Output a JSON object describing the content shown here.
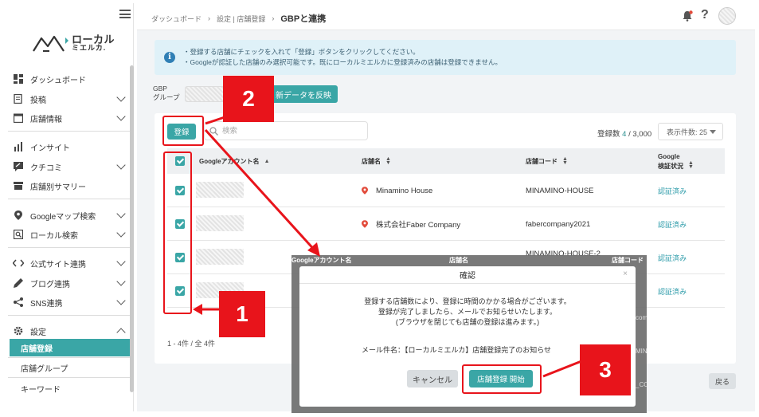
{
  "sidebar": {
    "logo_line1": "ローカル",
    "logo_line2": "ミエルカ.",
    "items": [
      {
        "label": "ダッシュボード",
        "icon": "dashboard-icon"
      },
      {
        "label": "投稿",
        "icon": "post-icon"
      },
      {
        "label": "店舗情報",
        "icon": "store-icon"
      },
      {
        "label": "インサイト",
        "icon": "insight-icon"
      },
      {
        "label": "クチコミ",
        "icon": "review-icon"
      },
      {
        "label": "店舗別サマリー",
        "icon": "shop-summary-icon"
      },
      {
        "label": "Googleマップ検索",
        "icon": "map-pin-icon"
      },
      {
        "label": "ローカル検索",
        "icon": "local-search-icon"
      },
      {
        "label": "公式サイト連携",
        "icon": "code-icon"
      },
      {
        "label": "ブログ連携",
        "icon": "pen-icon"
      },
      {
        "label": "SNS連携",
        "icon": "share-icon"
      },
      {
        "label": "設定",
        "icon": "gear-icon"
      }
    ],
    "sub_items": [
      "店舗登録",
      "店舗グループ",
      "キーワード"
    ]
  },
  "header": {
    "breadcrumb": [
      "ダッシュボード",
      "設定 | 店舗登録"
    ],
    "title": "GBPと連携"
  },
  "info": {
    "line1": "・登録する店舗にチェックを入れて「登録」ボタンをクリックしてください。",
    "line2": "・Googleが認証した店舗のみ選択可能です。既にローカルミエルカに登録済みの店舗は登録できません。"
  },
  "gbp": {
    "label_line1": "GBP",
    "label_line2": "グループ",
    "reflect_button": "新データを反映"
  },
  "toolbar": {
    "register_button": "登録",
    "search_placeholder": "検索",
    "count_prefix": "登録数",
    "count_current": "4",
    "count_total": " / 3,000",
    "per_page": "表示件数: 25"
  },
  "table": {
    "headers": {
      "account": "Googleアカウント名",
      "store": "店舗名",
      "code": "店舗コード",
      "google_line1": "Google",
      "google_line2": "検証状況"
    },
    "rows": [
      {
        "store": "Minamino House",
        "code": "MINAMINO-HOUSE",
        "status": "認証済み"
      },
      {
        "store": "株式会社Faber Company",
        "code": "fabercompany2021",
        "status": "認証済み"
      },
      {
        "store": "",
        "code": "MINAMINO-HOUSE-2",
        "status": "認証済み"
      },
      {
        "store": "",
        "code": "",
        "status": "認証済み"
      }
    ],
    "pager": "1 - 4件 / 全 4件"
  },
  "back_button": "戻る",
  "dialog": {
    "header_account": "Googleアカウント名",
    "header_store": "店舗名",
    "header_code": "店舗コード",
    "bg_right_1": "com",
    "bg_right_2": "MIN",
    "bg_right_3": "_CO",
    "title": "確認",
    "close": "×",
    "body_line1": "登録する店舗数により、登録に時間のかかる場合がございます。",
    "body_line2": "登録が完了しましたら、メールでお知らせいたします。",
    "body_line3": "(ブラウザを閉じても店舗の登録は進みます。)",
    "mail_subject": "メール件名：【ローカルミエルカ】店舗登録完了のお知らせ",
    "cancel_button": "キャンセル",
    "start_button": "店舗登録 開始"
  },
  "annotations": {
    "step1": "1",
    "step2": "2",
    "step3": "3",
    "color": "#e8141b"
  },
  "colors": {
    "accent": "#3aa6a6",
    "info_bg": "#dff1f8",
    "pin": "#e24b3b"
  }
}
